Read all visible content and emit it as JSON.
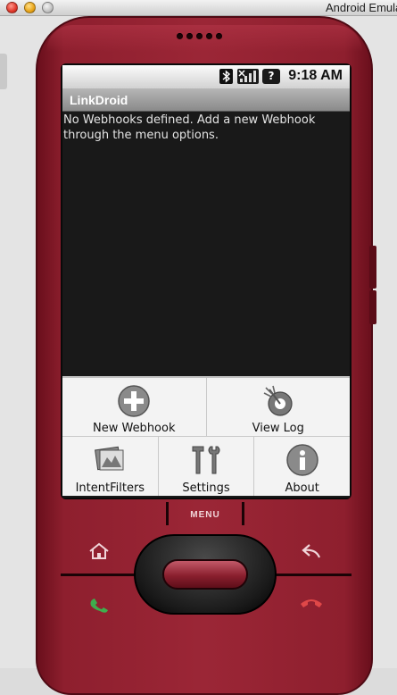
{
  "window": {
    "title": "Android Emulator"
  },
  "status_bar": {
    "time": "9:18 AM",
    "icons": [
      "bluetooth-icon",
      "signal-icon",
      "unknown-network-icon"
    ]
  },
  "app": {
    "title": "LinkDroid",
    "message": "No Webhooks defined. Add a new Webhook through the menu options."
  },
  "menu": {
    "row1": [
      {
        "label": "New Webhook",
        "icon": "add-icon"
      },
      {
        "label": "View Log",
        "icon": "log-icon"
      }
    ],
    "row2": [
      {
        "label": "IntentFilters",
        "icon": "gallery-icon"
      },
      {
        "label": "Settings",
        "icon": "tools-icon"
      },
      {
        "label": "About",
        "icon": "info-icon"
      }
    ]
  },
  "hardware": {
    "menu_key_label": "MENU"
  },
  "colors": {
    "phone_body": "#9b2636",
    "screen_bg": "#191919",
    "menu_bg": "#f3f3f3",
    "title_bar": "#8a8a8a"
  }
}
